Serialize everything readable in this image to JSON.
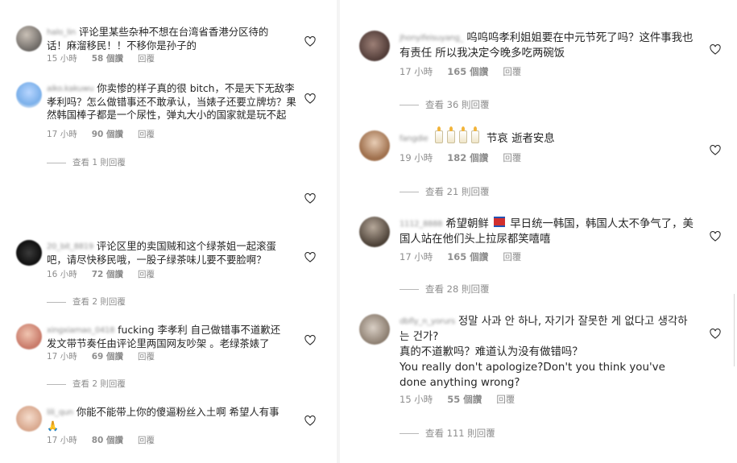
{
  "left_comments": [
    {
      "username": "halo_lin",
      "text": "评论里某些杂种不想在台湾省香港分区待的话！麻溜移民！！不移你是孙子的",
      "time": "15 小時",
      "likes": "58 個讚",
      "reply": "回覆",
      "view_replies": ""
    },
    {
      "username": "aiko.kakuwu",
      "text": "你卖惨的样子真的很 bitch，不是天下无敌李孝利吗？怎么做错事还不敢承认，当婊子还要立牌坊？果然韩国棒子都是一个尿性，弹丸大小的国家就是玩不起",
      "time": "17 小時",
      "likes": "90 個讚",
      "reply": "回覆",
      "view_replies": "查看 1 則回覆"
    },
    {
      "username": "20_bit_8819",
      "text": "评论区里的卖国贼和这个绿茶姐一起滚蛋吧，请尽快移民哦，一股子绿茶味儿要不要脸啊？",
      "time": "16 小時",
      "likes": "72 個讚",
      "reply": "回覆",
      "view_replies": "查看 2 則回覆"
    },
    {
      "username": "xingxiamao_0418",
      "text": "fucking 李孝利 自己做错事不道歉还发文带节奏任由评论里两国网友吵架 。老绿茶婊了",
      "time": "17 小時",
      "likes": "69 個讚",
      "reply": "回覆",
      "view_replies": "查看 2 則回覆"
    },
    {
      "username": "lili_qun",
      "text": "你能不能带上你的傻逼粉丝入土啊 希望人有事",
      "time": "17 小時",
      "likes": "80 個讚",
      "reply": "回覆",
      "view_replies": ""
    }
  ],
  "right_comments": [
    {
      "username": "jhonyifeisuyang_",
      "text": "呜呜呜孝利姐姐要在中元节死了吗？这件事我也有责任 所以我决定今晚多吃两碗饭",
      "time": "17 小時",
      "likes": "165 個讚",
      "reply": "回覆",
      "view_replies": "查看 36 則回覆"
    },
    {
      "username": "fangdie",
      "text": "节哀 逝者安息",
      "time": "19 小時",
      "likes": "182 個讚",
      "reply": "回覆",
      "view_replies": "查看 21 則回覆"
    },
    {
      "username": "1112_8888",
      "text_a": "希望朝鲜",
      "text_b": "早日统一韩国，韩国人太不争气了，美国人站在他们头上拉尿都笑嘻嘻",
      "time": "17 小時",
      "likes": "165 個讚",
      "reply": "回覆",
      "view_replies": "查看 28 則回覆"
    },
    {
      "username": "dbfly_n_yorurs",
      "text_line1": "정말 사과 안 하나, 자기가 잘못한 게 없다고 생각하는 건가?",
      "text_line2": "真的不道歉吗？难道认为没有做错吗？",
      "text_line3": "You really don't apologize?Don't you think you've done anything wrong?",
      "time": "15 小時",
      "likes": "55 個讚",
      "reply": "回覆",
      "view_replies": "查看 111 則回覆"
    }
  ],
  "colors": {
    "text": "#262626",
    "meta": "#8e8e8e",
    "heart_stroke": "#262626"
  },
  "icons": {
    "like": "heart-outline-icon"
  }
}
